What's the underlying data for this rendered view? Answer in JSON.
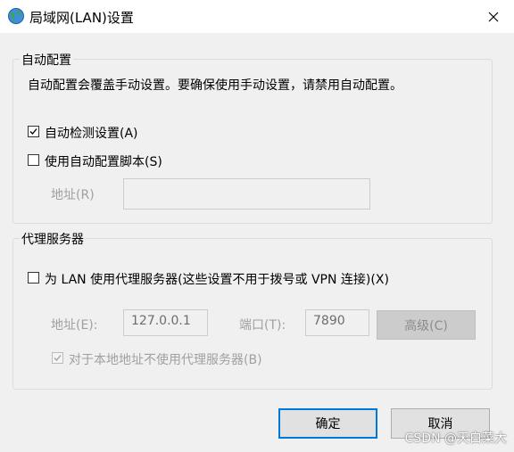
{
  "window": {
    "title": "局域网(LAN)设置",
    "close_icon": "close-icon"
  },
  "auto_config": {
    "group_label": "自动配置",
    "description": "自动配置会覆盖手动设置。要确保使用手动设置，请禁用自动配置。",
    "auto_detect": {
      "label": "自动检测设置(A)",
      "checked": true
    },
    "use_script": {
      "label": "使用自动配置脚本(S)",
      "checked": false
    },
    "address": {
      "label": "地址(R)",
      "value": ""
    }
  },
  "proxy": {
    "group_label": "代理服务器",
    "use_proxy": {
      "label": "为 LAN 使用代理服务器(这些设置不用于拨号或 VPN 连接)(X)",
      "checked": false
    },
    "address": {
      "label": "地址(E):",
      "value": "127.0.0.1"
    },
    "port": {
      "label": "端口(T):",
      "value": "7890"
    },
    "advanced_label": "高级(C)",
    "bypass_local": {
      "label": "对于本地地址不使用代理服务器(B)",
      "checked": true
    }
  },
  "buttons": {
    "ok_label": "确定",
    "cancel_label": "取消"
  },
  "watermark": "CSDN @天白菜大",
  "colors": {
    "accent": "#0078d7",
    "background": "#f0f0f0",
    "disabled_text": "#a0a0a0"
  }
}
